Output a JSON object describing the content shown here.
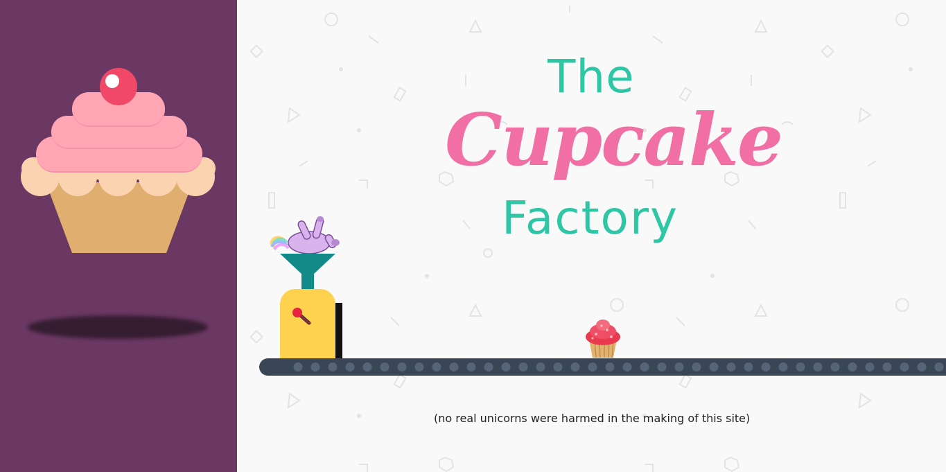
{
  "title": {
    "line1": "The",
    "line2": "Cupcake",
    "line3": "Factory"
  },
  "disclaimer": "(no real unicorns were harmed in the making of this site)",
  "colors": {
    "sidebar": "#6b3863",
    "background": "#f9f9f9",
    "accent_teal": "#2fc6a6",
    "accent_pink": "#f16fa4",
    "conveyor": "#3a4656",
    "machine": "#fed14e",
    "funnel": "#138a8a"
  },
  "icons": {
    "sidebar_graphic": "cupcake-icon",
    "machine_input": "unicorn-icon",
    "belt_item": "cupcake-icon"
  }
}
